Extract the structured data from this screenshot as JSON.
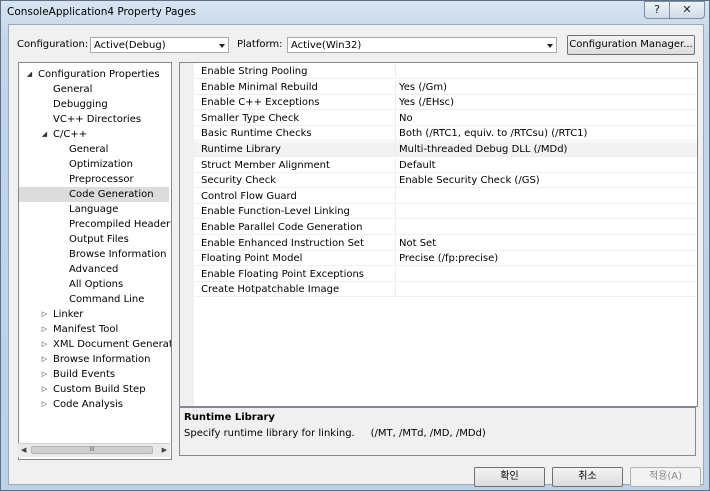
{
  "window": {
    "title": "ConsoleApplication4 Property Pages",
    "help": "?",
    "close": "✕"
  },
  "toolbar": {
    "configuration_label": "Configuration:",
    "configuration_value": "Active(Debug)",
    "platform_label": "Platform:",
    "platform_value": "Active(Win32)",
    "config_manager_button": "Configuration Manager..."
  },
  "tree": {
    "items": [
      {
        "label": "Configuration Properties",
        "expander": "◢"
      },
      {
        "label": "General"
      },
      {
        "label": "Debugging"
      },
      {
        "label": "VC++ Directories"
      },
      {
        "label": "C/C++",
        "expander": "◢"
      },
      {
        "label": "General"
      },
      {
        "label": "Optimization"
      },
      {
        "label": "Preprocessor"
      },
      {
        "label": "Code Generation"
      },
      {
        "label": "Language"
      },
      {
        "label": "Precompiled Headers"
      },
      {
        "label": "Output Files"
      },
      {
        "label": "Browse Information"
      },
      {
        "label": "Advanced"
      },
      {
        "label": "All Options"
      },
      {
        "label": "Command Line"
      },
      {
        "label": "Linker",
        "expander": "▷"
      },
      {
        "label": "Manifest Tool",
        "expander": "▷"
      },
      {
        "label": "XML Document Generator",
        "expander": "▷"
      },
      {
        "label": "Browse Information",
        "expander": "▷"
      },
      {
        "label": "Build Events",
        "expander": "▷"
      },
      {
        "label": "Custom Build Step",
        "expander": "▷"
      },
      {
        "label": "Code Analysis",
        "expander": "▷"
      }
    ],
    "selected_index": 8,
    "scroll_left": "◀",
    "scroll_right": "▶",
    "scroll_thumb": "III"
  },
  "properties": {
    "rows": [
      {
        "name": "Enable String Pooling",
        "value": ""
      },
      {
        "name": "Enable Minimal Rebuild",
        "value": "Yes (/Gm)"
      },
      {
        "name": "Enable C++ Exceptions",
        "value": "Yes (/EHsc)"
      },
      {
        "name": "Smaller Type Check",
        "value": "No"
      },
      {
        "name": "Basic Runtime Checks",
        "value": "Both (/RTC1, equiv. to /RTCsu) (/RTC1)"
      },
      {
        "name": "Runtime Library",
        "value": "Multi-threaded Debug DLL (/MDd)"
      },
      {
        "name": "Struct Member Alignment",
        "value": "Default"
      },
      {
        "name": "Security Check",
        "value": "Enable Security Check (/GS)"
      },
      {
        "name": "Control Flow Guard",
        "value": ""
      },
      {
        "name": "Enable Function-Level Linking",
        "value": ""
      },
      {
        "name": "Enable Parallel Code Generation",
        "value": ""
      },
      {
        "name": "Enable Enhanced Instruction Set",
        "value": "Not Set"
      },
      {
        "name": "Floating Point Model",
        "value": "Precise (/fp:precise)"
      },
      {
        "name": "Enable Floating Point Exceptions",
        "value": ""
      },
      {
        "name": "Create Hotpatchable Image",
        "value": ""
      }
    ],
    "selected_index": 5
  },
  "description": {
    "title": "Runtime Library",
    "text": "Specify runtime library for linking.     (/MT, /MTd, /MD, /MDd)"
  },
  "buttons": {
    "ok": "확인",
    "cancel": "취소",
    "apply": "적용(A)"
  }
}
